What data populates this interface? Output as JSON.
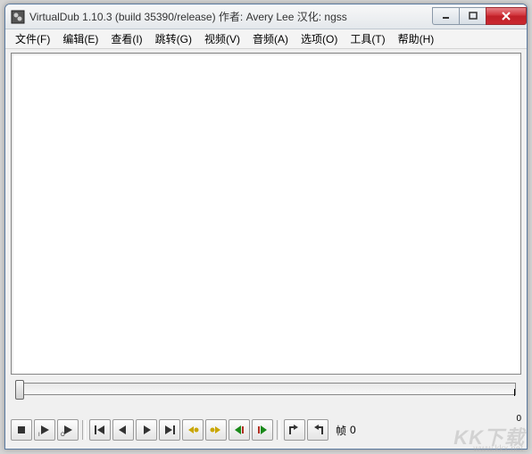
{
  "window": {
    "title": "VirtualDub 1.10.3 (build 35390/release) 作者: Avery Lee  汉化: ngss"
  },
  "menu": {
    "items": [
      {
        "label": "文件(F)"
      },
      {
        "label": "编辑(E)"
      },
      {
        "label": "查看(I)"
      },
      {
        "label": "跳转(G)"
      },
      {
        "label": "视频(V)"
      },
      {
        "label": "音频(A)"
      },
      {
        "label": "选项(O)"
      },
      {
        "label": "工具(T)"
      },
      {
        "label": "帮助(H)"
      }
    ]
  },
  "seek": {
    "end_label": "0"
  },
  "toolbar": {
    "icons": [
      "stop-icon",
      "play-input-icon",
      "play-output-icon",
      "start-icon",
      "back-icon",
      "forward-icon",
      "end-icon",
      "key-prev-icon",
      "key-next-icon",
      "scene-prev-icon",
      "scene-next-icon",
      "mark-in-icon",
      "mark-out-icon"
    ],
    "frame_label": "帧",
    "frame_value": "0"
  },
  "watermark": {
    "main": "KK下载",
    "sub": "www.kkx.net"
  }
}
